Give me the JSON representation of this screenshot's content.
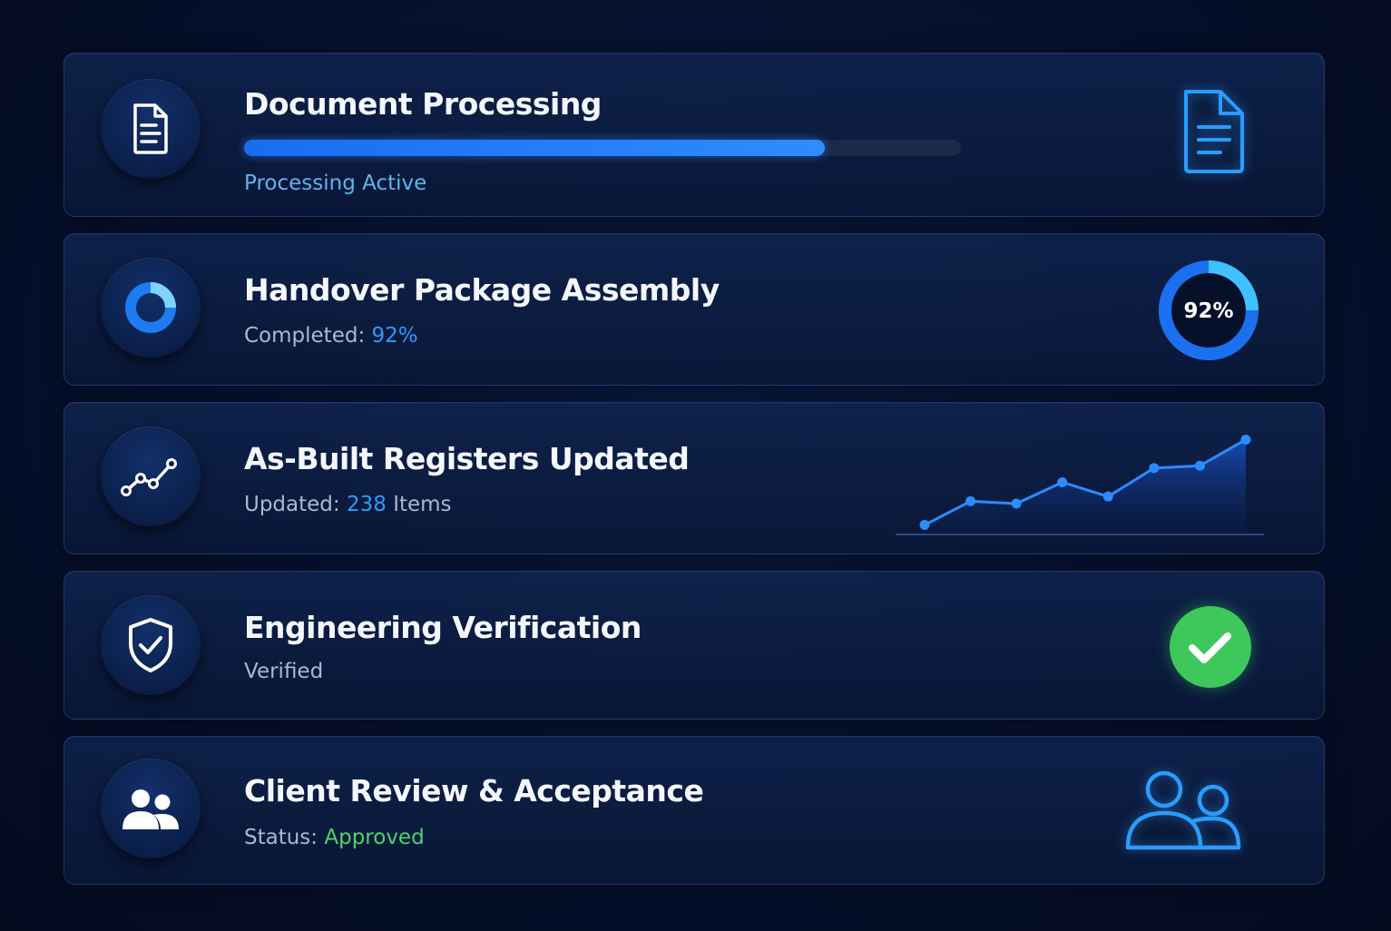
{
  "colors": {
    "accent_blue": "#2a9cff",
    "bar_blue": "#1a6cf0",
    "donut_light": "#3fc0ff",
    "success_green": "#3ec85c",
    "approved_green": "#4ed36a"
  },
  "cards": [
    {
      "title": "Document Processing",
      "status": "Processing Active",
      "progress_fraction": 0.81,
      "left_icon": "document-icon",
      "right_icon": "document-icon"
    },
    {
      "title": "Handover Package Assembly",
      "status_label": "Completed:",
      "status_value": "92%",
      "donut_value": "92%",
      "donut_fraction": 0.92,
      "left_icon": "donut-chart-icon"
    },
    {
      "title": "As-Built Registers Updated",
      "status_label": "Updated:",
      "status_value": "238",
      "status_unit": "Items",
      "left_icon": "trend-line-icon"
    },
    {
      "title": "Engineering Verification",
      "status": "Verified",
      "left_icon": "shield-check-icon",
      "right_icon": "check-circle-icon"
    },
    {
      "title": "Client Review & Acceptance",
      "status_label": "Status:",
      "status_value": "Approved",
      "left_icon": "users-icon",
      "right_icon": "users-outline-icon"
    }
  ],
  "chart_data": {
    "type": "area",
    "x": [
      1,
      2,
      3,
      4,
      5,
      6,
      7,
      8
    ],
    "values": [
      2,
      7,
      6.5,
      11,
      8,
      14,
      14.5,
      20
    ],
    "ylim": [
      0,
      22
    ],
    "title": "",
    "xlabel": "",
    "ylabel": "",
    "grid": false
  }
}
